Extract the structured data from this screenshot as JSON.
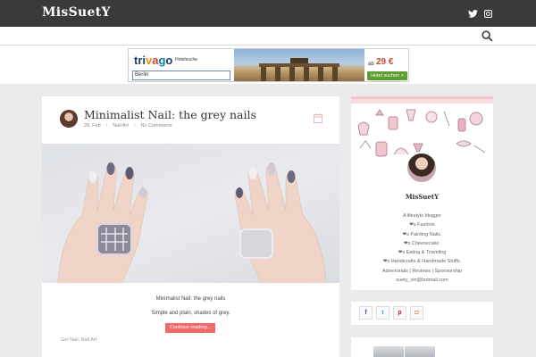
{
  "site": {
    "title": "MisSuetY"
  },
  "header_social": {
    "twitter_icon": "twitter-icon",
    "instagram_icon": "instagram-icon"
  },
  "nav": {
    "search_icon": "search-icon"
  },
  "ad": {
    "logo": {
      "p1": "tri",
      "p2": "v",
      "p3": "a",
      "p4": "g",
      "p5": "o"
    },
    "subtitle": "Hotelsuche",
    "input_value": "Berlin",
    "price_prefix": "ab",
    "price": "29 €",
    "button": "Hotel suchen >"
  },
  "post": {
    "title": "Minimalist Nail: the grey nails",
    "meta": {
      "date": "28. Feb",
      "separator": "/",
      "category": "Nail Art",
      "comments": "No Comments"
    },
    "caption_title": "Minimalist Nail: the grey nails",
    "caption_text": "Simple and plain, shades of grey.",
    "continue_label": "Continue reading...",
    "tags": "Gel Nail, Nail Art"
  },
  "about": {
    "name": "MisSuetY",
    "lines": [
      "A lifestyle blogger",
      "❤s Fashion",
      "❤s Painting Nails.",
      "❤s Cheesecake.",
      "❤s Eating & Traveling",
      "❤s Handicrafts & Handmade Stuffs.",
      "Advertorials | Reviews | Sponsorship",
      "suety_vin@hotmail.com"
    ]
  },
  "social_widget": {
    "facebook": "f",
    "twitter": "t",
    "pinterest": "p",
    "instagram": "◘"
  },
  "colors": {
    "topbar": "#3a3a3a",
    "accent": "#f06a6a",
    "background": "#ebebeb"
  }
}
